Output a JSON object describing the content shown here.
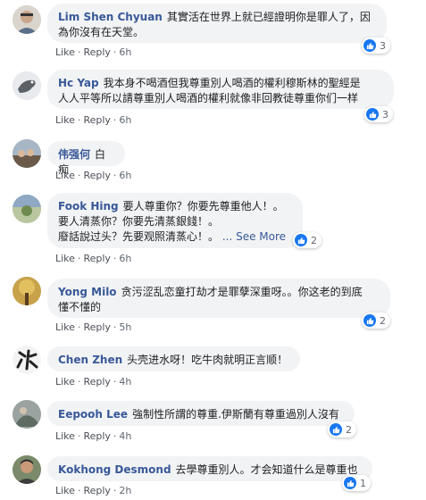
{
  "actions": {
    "like": "Like",
    "reply": "Reply",
    "dot": "·"
  },
  "comments": [
    {
      "author": "Lim Shen Chyuan",
      "lines": [
        "其實活在世界上就已經證明你是罪人了，因",
        "為你沒有在天堂。"
      ],
      "time": "6h",
      "reactions": "3"
    },
    {
      "author": "Hc Yap",
      "lines": [
        "我本身不喝酒但我尊重別人喝酒的權利穆斯林的聖經是",
        "人人平等所以請尊重別人喝酒的權利就像非回教徒尊重你们一样"
      ],
      "time": "6h",
      "reactions": "3"
    },
    {
      "author": "伟强何",
      "lines": [
        "白痴"
      ],
      "time": "6h",
      "reactions": ""
    },
    {
      "author": "Fook Hing",
      "lines": [
        "要人尊重你？你要先尊重他人！。",
        "要人清蒸你？你要先清蒸銀錢！。",
        "廢話說过头？先要观照清蒸心！。"
      ],
      "see_more": "... See More",
      "time": "6h",
      "reactions": "2"
    },
    {
      "author": "Yong Milo",
      "lines": [
        "贪污涩乱恋童打劫才是罪孽深重呀。。你这老的到底",
        "懂不懂的"
      ],
      "time": "5h",
      "reactions": "2"
    },
    {
      "author": "Chen Zhen",
      "lines": [
        "头壳进水呀！吃牛肉就明正言顺！"
      ],
      "time": "4h",
      "reactions": ""
    },
    {
      "author": "Eepooh Lee",
      "lines": [
        "強制性所謂的尊重.伊斯蘭有尊重過別人沒有"
      ],
      "time": "4h",
      "reactions": "2"
    },
    {
      "author": "Kokhong Desmond",
      "lines": [
        "去學尊重別人。才会知道什么是尊重也"
      ],
      "time": "2h",
      "reactions": "1"
    }
  ]
}
